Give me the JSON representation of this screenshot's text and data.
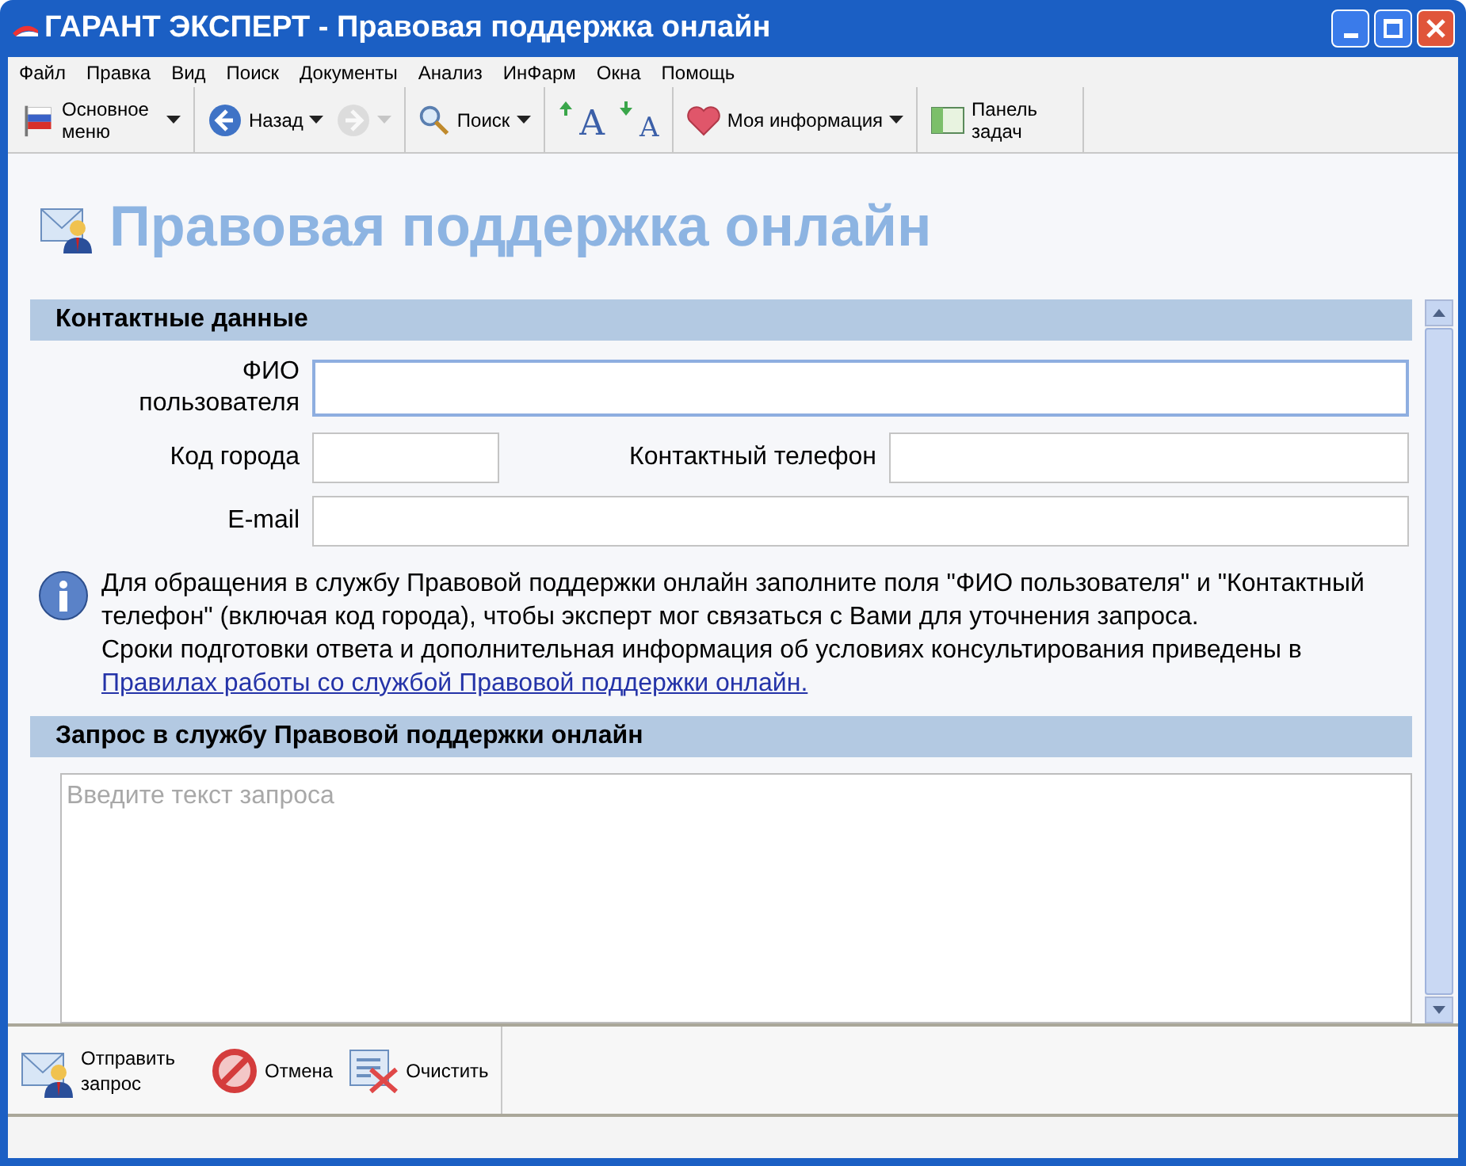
{
  "window": {
    "title": "ГАРАНТ ЭКСПЕРТ - Правовая поддержка онлайн"
  },
  "menu": [
    "Файл",
    "Правка",
    "Вид",
    "Поиск",
    "Документы",
    "Анализ",
    "ИнФарм",
    "Окна",
    "Помощь"
  ],
  "toolbar": [
    {
      "kind": "flag",
      "label": "Основное меню",
      "dropdown": true
    },
    {
      "kind": "back",
      "label": "Назад",
      "dropdown": true,
      "disabled": false
    },
    {
      "kind": "forward",
      "dropdown": true,
      "disabled": true
    },
    {
      "kind": "search",
      "label": "Поиск",
      "dropdown": true
    },
    {
      "kind": "font-up",
      "glyph": "A"
    },
    {
      "kind": "font-down",
      "glyph": "A"
    },
    {
      "kind": "heart",
      "label": "Моя информация",
      "dropdown": true
    },
    {
      "kind": "panel",
      "label": "Панель задач"
    }
  ],
  "page": {
    "title": "Правовая поддержка онлайн"
  },
  "contact": {
    "heading": "Контактные данные",
    "fields": [
      {
        "label": "ФИО пользователя",
        "focused": true
      },
      {
        "label": "Код города",
        "focused": false
      },
      {
        "label": "Контактный телефон",
        "focused": false
      },
      {
        "label": "E-mail",
        "focused": false
      }
    ],
    "info": {
      "text": "Для обращения в службу Правовой поддержки онлайн заполните поля \"ФИО пользователя\" и \"Контактный телефон\" (включая код города), чтобы эксперт мог связаться с Вами для уточнения запроса.",
      "text2": "Сроки подготовки ответа и дополнительная информация об условиях консультирования приведены в ",
      "link": "Правилах работы со службой Правовой поддержки онлайн."
    }
  },
  "request": {
    "heading": "Запрос в службу Правовой поддержки онлайн",
    "placeholder": "Введите текст запроса"
  },
  "actions": [
    {
      "kind": "send",
      "label": "Отправить запрос"
    },
    {
      "kind": "cancel",
      "label": "Отмена"
    },
    {
      "kind": "clear",
      "label": "Очистить"
    }
  ]
}
